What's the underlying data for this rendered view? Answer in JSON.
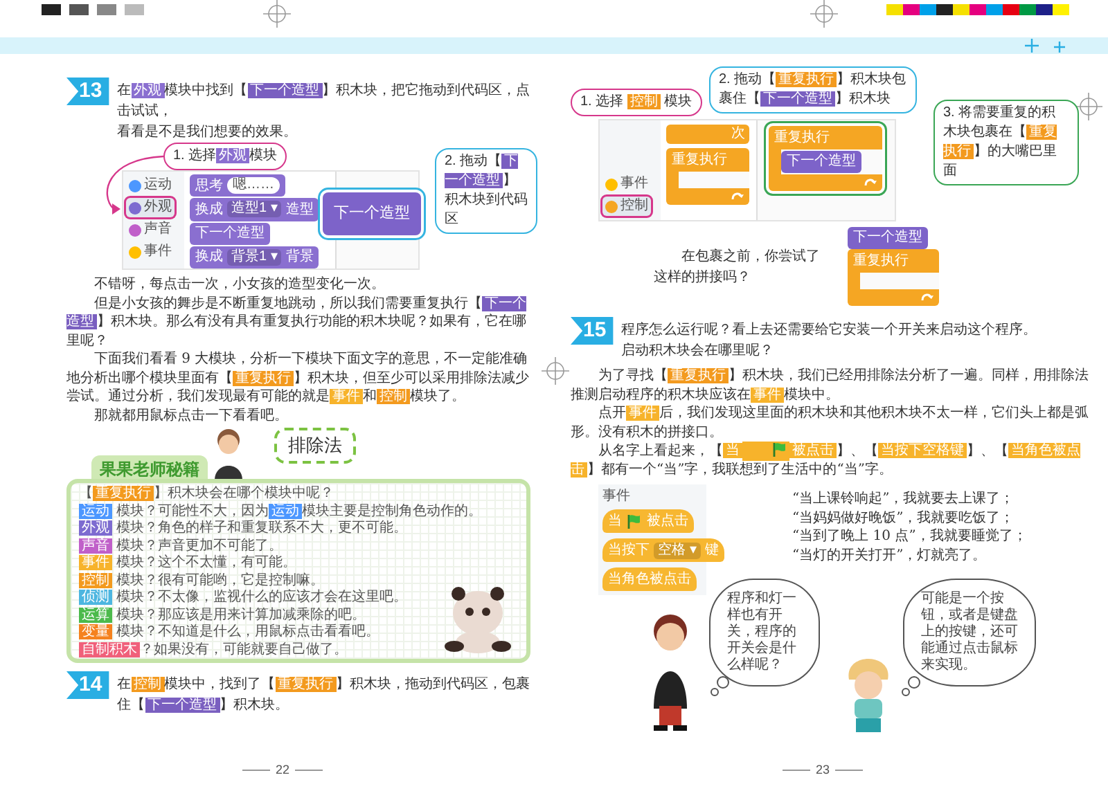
{
  "left_page": {
    "step_13": {
      "number": "13",
      "lines": [
        [
          {
            "text": "在"
          },
          {
            "text": "外观",
            "color": "#8a6fd0"
          },
          {
            "text": "模块中找到【"
          },
          {
            "text": "下一个造型",
            "color": "#7a5fc0"
          },
          {
            "text": "】积木块，把它拖动到代码区，点击试试，"
          }
        ],
        [
          {
            "text": "看看是不是我们想要的效果。"
          }
        ]
      ]
    },
    "figure_13": {
      "palette": [
        {
          "label": "运动",
          "color": "#4c97ff",
          "selected": false
        },
        {
          "label": "外观",
          "color": "#7d6bd0",
          "selected": true
        },
        {
          "label": "声音",
          "color": "#c05fc9",
          "selected": false
        },
        {
          "label": "事件",
          "color": "#ffbf00",
          "selected": false
        }
      ],
      "blocks": [
        {
          "before": "思考",
          "input": "嗯……"
        },
        {
          "before": "换成",
          "dropdown": "造型1 ▾",
          "after": "造型"
        },
        {
          "before": "下一个造型"
        },
        {
          "before": "换成",
          "dropdown": "背景1 ▾",
          "after": "背景"
        }
      ],
      "code_block": "下一个造型",
      "callouts": [
        [
          {
            "text": "1. 选择"
          },
          {
            "text": "外观",
            "color": "#8a6fd0"
          },
          {
            "text": "模块"
          }
        ],
        [
          {
            "text": "2. 拖动【"
          },
          {
            "text": "下一个造型",
            "color": "#7a5fc0"
          },
          {
            "text": "】积木块到代码区"
          }
        ]
      ]
    },
    "paragraphs": [
      [
        {
          "text": "不错呀，每点击一次，小女孩的造型变化一次。"
        }
      ],
      [
        {
          "text": "但是小女孩的舞步是不断重复地跳动，所以我们需要重复执行【"
        },
        {
          "text": "下一个造型",
          "color": "#7a5fc0"
        },
        {
          "text": "】积木块。那么有没有具有重复执行功能的积木块呢？如果有，它在哪里呢？"
        }
      ],
      [
        {
          "text": "下面我们看看 9 大模块，分析一下模块下面文字的意思，不一定能准确地分析出哪个模块里面有【"
        },
        {
          "text": "重复执行",
          "color": "#f39a1e"
        },
        {
          "text": "】积木块，但至少可以采用排除法减少尝试。通过分析，我们发现最有可能的就是"
        },
        {
          "text": "事件",
          "color": "#f7b32b"
        },
        {
          "text": "和"
        },
        {
          "text": "控制",
          "color": "#f39a1e"
        },
        {
          "text": "模块了。"
        }
      ],
      [
        {
          "text": "那就都用鼠标点击一下看看吧。"
        }
      ]
    ],
    "tips": {
      "title": "果果老师秘籍",
      "bubble": "排除法",
      "rows": [
        [
          {
            "text": "【"
          },
          {
            "text": "重复执行",
            "color": "#f39a1e"
          },
          {
            "text": "】积木块会在哪个模块中呢？"
          }
        ],
        [
          {
            "text": "运动",
            "color": "#4c97ff"
          },
          {
            "text": " 模块？可能性不大，因为"
          },
          {
            "text": "运动",
            "color": "#4c97ff"
          },
          {
            "text": "模块主要是控制角色动作的。"
          }
        ],
        [
          {
            "text": "外观",
            "color": "#7d6bd0"
          },
          {
            "text": " 模块？角色的样子和重复联系不大，更不可能。"
          }
        ],
        [
          {
            "text": "声音",
            "color": "#c05fc9"
          },
          {
            "text": " 模块？声音更加不可能了。"
          }
        ],
        [
          {
            "text": "事件",
            "color": "#f7b32b"
          },
          {
            "text": " 模块？这个不太懂，有可能。"
          }
        ],
        [
          {
            "text": "控制",
            "color": "#f39a1e"
          },
          {
            "text": " 模块？很有可能哟，它是控制嘛。"
          }
        ],
        [
          {
            "text": "侦测",
            "color": "#4db6e0"
          },
          {
            "text": " 模块？不太像，监视什么的应该才会在这里吧。"
          }
        ],
        [
          {
            "text": "运算",
            "color": "#4cba4c"
          },
          {
            "text": " 模块？那应该是用来计算加减乘除的吧。"
          }
        ],
        [
          {
            "text": "变量",
            "color": "#f5821f"
          },
          {
            "text": " 模块？不知道是什么，用鼠标点击看看吧。"
          }
        ],
        [
          {
            "text": "自制积木",
            "color": "#f0607a"
          },
          {
            "text": "？如果没有，可能就要自己做了。"
          }
        ]
      ]
    },
    "step_14": {
      "number": "14",
      "lines": [
        [
          {
            "text": "在"
          },
          {
            "text": "控制",
            "color": "#f39a1e"
          },
          {
            "text": "模块中，找到了【"
          },
          {
            "text": "重复执行",
            "color": "#f39a1e"
          },
          {
            "text": "】积木块，拖动到代码区，包裹住【"
          },
          {
            "text": "下一个造型",
            "color": "#7a5fc0"
          },
          {
            "text": "】积木块。"
          }
        ]
      ]
    },
    "page_number": "22"
  },
  "right_page": {
    "figure_14": {
      "palette": [
        {
          "label": "事件",
          "color": "#ffbf00",
          "selected": false
        },
        {
          "label": "控制",
          "color": "#f5a623",
          "selected": true
        }
      ],
      "partial_block": "次",
      "c_block": "重复执行",
      "code_c_block": "重复执行",
      "code_inner_block": "下一个造型",
      "callouts": [
        [
          {
            "text": "1. 选择 "
          },
          {
            "text": "控制",
            "color": "#f39a1e"
          },
          {
            "text": " 模块"
          }
        ],
        [
          {
            "text": "2. 拖动【"
          },
          {
            "text": "重复执行",
            "color": "#f39a1e"
          },
          {
            "text": "】积木块包裹住【"
          },
          {
            "text": "下一个造型",
            "color": "#7a5fc0"
          },
          {
            "text": "】积木块"
          }
        ],
        [
          {
            "text": "3. 将需要重复的积木块包裹在【"
          },
          {
            "text": "重复执行",
            "color": "#f39a1e"
          },
          {
            "text": "】的大嘴巴里面"
          }
        ]
      ]
    },
    "question": "在包裹之前，你尝试了这样的拼接吗？",
    "example_stack": {
      "top_block": "下一个造型",
      "c_block": "重复执行"
    },
    "step_15": {
      "number": "15",
      "lines": [
        [
          {
            "text": "程序怎么运行呢？看上去还需要给它安装一个开关来启动这个程序。"
          }
        ],
        [
          {
            "text": "启动积木块会在哪里呢？"
          }
        ]
      ]
    },
    "paragraphs": [
      [
        {
          "text": "为了寻找【"
        },
        {
          "text": "重复执行",
          "color": "#f39a1e"
        },
        {
          "text": "】积木块，我们已经用排除法分析了一遍。同样，用排除法推测启动程序的积木块应该在"
        },
        {
          "text": "事件",
          "color": "#f7b32b"
        },
        {
          "text": "模块中。"
        }
      ],
      [
        {
          "text": "点开"
        },
        {
          "text": "事件",
          "color": "#f7b32b"
        },
        {
          "text": "后，我们发现这里面的积木块和其他积木块不太一样，它们头上都是弧形。没有积木的拼接口。"
        }
      ],
      [
        {
          "text": "从名字上看起来，【"
        },
        {
          "text": "当",
          "color": "#f7b32b"
        },
        {
          "kind": "flag",
          "color": "#f7b32b"
        },
        {
          "text": "被点击",
          "color": "#f7b32b"
        },
        {
          "text": "】、【"
        },
        {
          "text": "当按下空格键",
          "color": "#f7b32b"
        },
        {
          "text": "】、【"
        },
        {
          "text": "当角色被点击",
          "color": "#f7b32b"
        },
        {
          "text": "】都有一个“当”字，我联想到了生活中的“当”字。"
        }
      ]
    ],
    "events_figure": {
      "title": "事件",
      "blocks": [
        {
          "before": "当",
          "flag": true,
          "after": "被点击"
        },
        {
          "before": "当按下",
          "dropdown": "空格 ▾",
          "after": "键"
        },
        {
          "before": "当角色被点击",
          "flag": false
        }
      ]
    },
    "quotes": [
      "“当上课铃响起”，我就要去上课了；",
      "“当妈妈做好晚饭”，我就要吃饭了；",
      "“当到了晚上 10 点”，我就要睡觉了；",
      "“当灯的开关打开”，灯就亮了。"
    ],
    "thoughts": [
      "程序和灯一样也有开关，程序的开关会是什么样呢？",
      "可能是一个按钮，或者是键盘上的按键，还可能通过点击鼠标来实现。"
    ],
    "page_number": "23"
  }
}
